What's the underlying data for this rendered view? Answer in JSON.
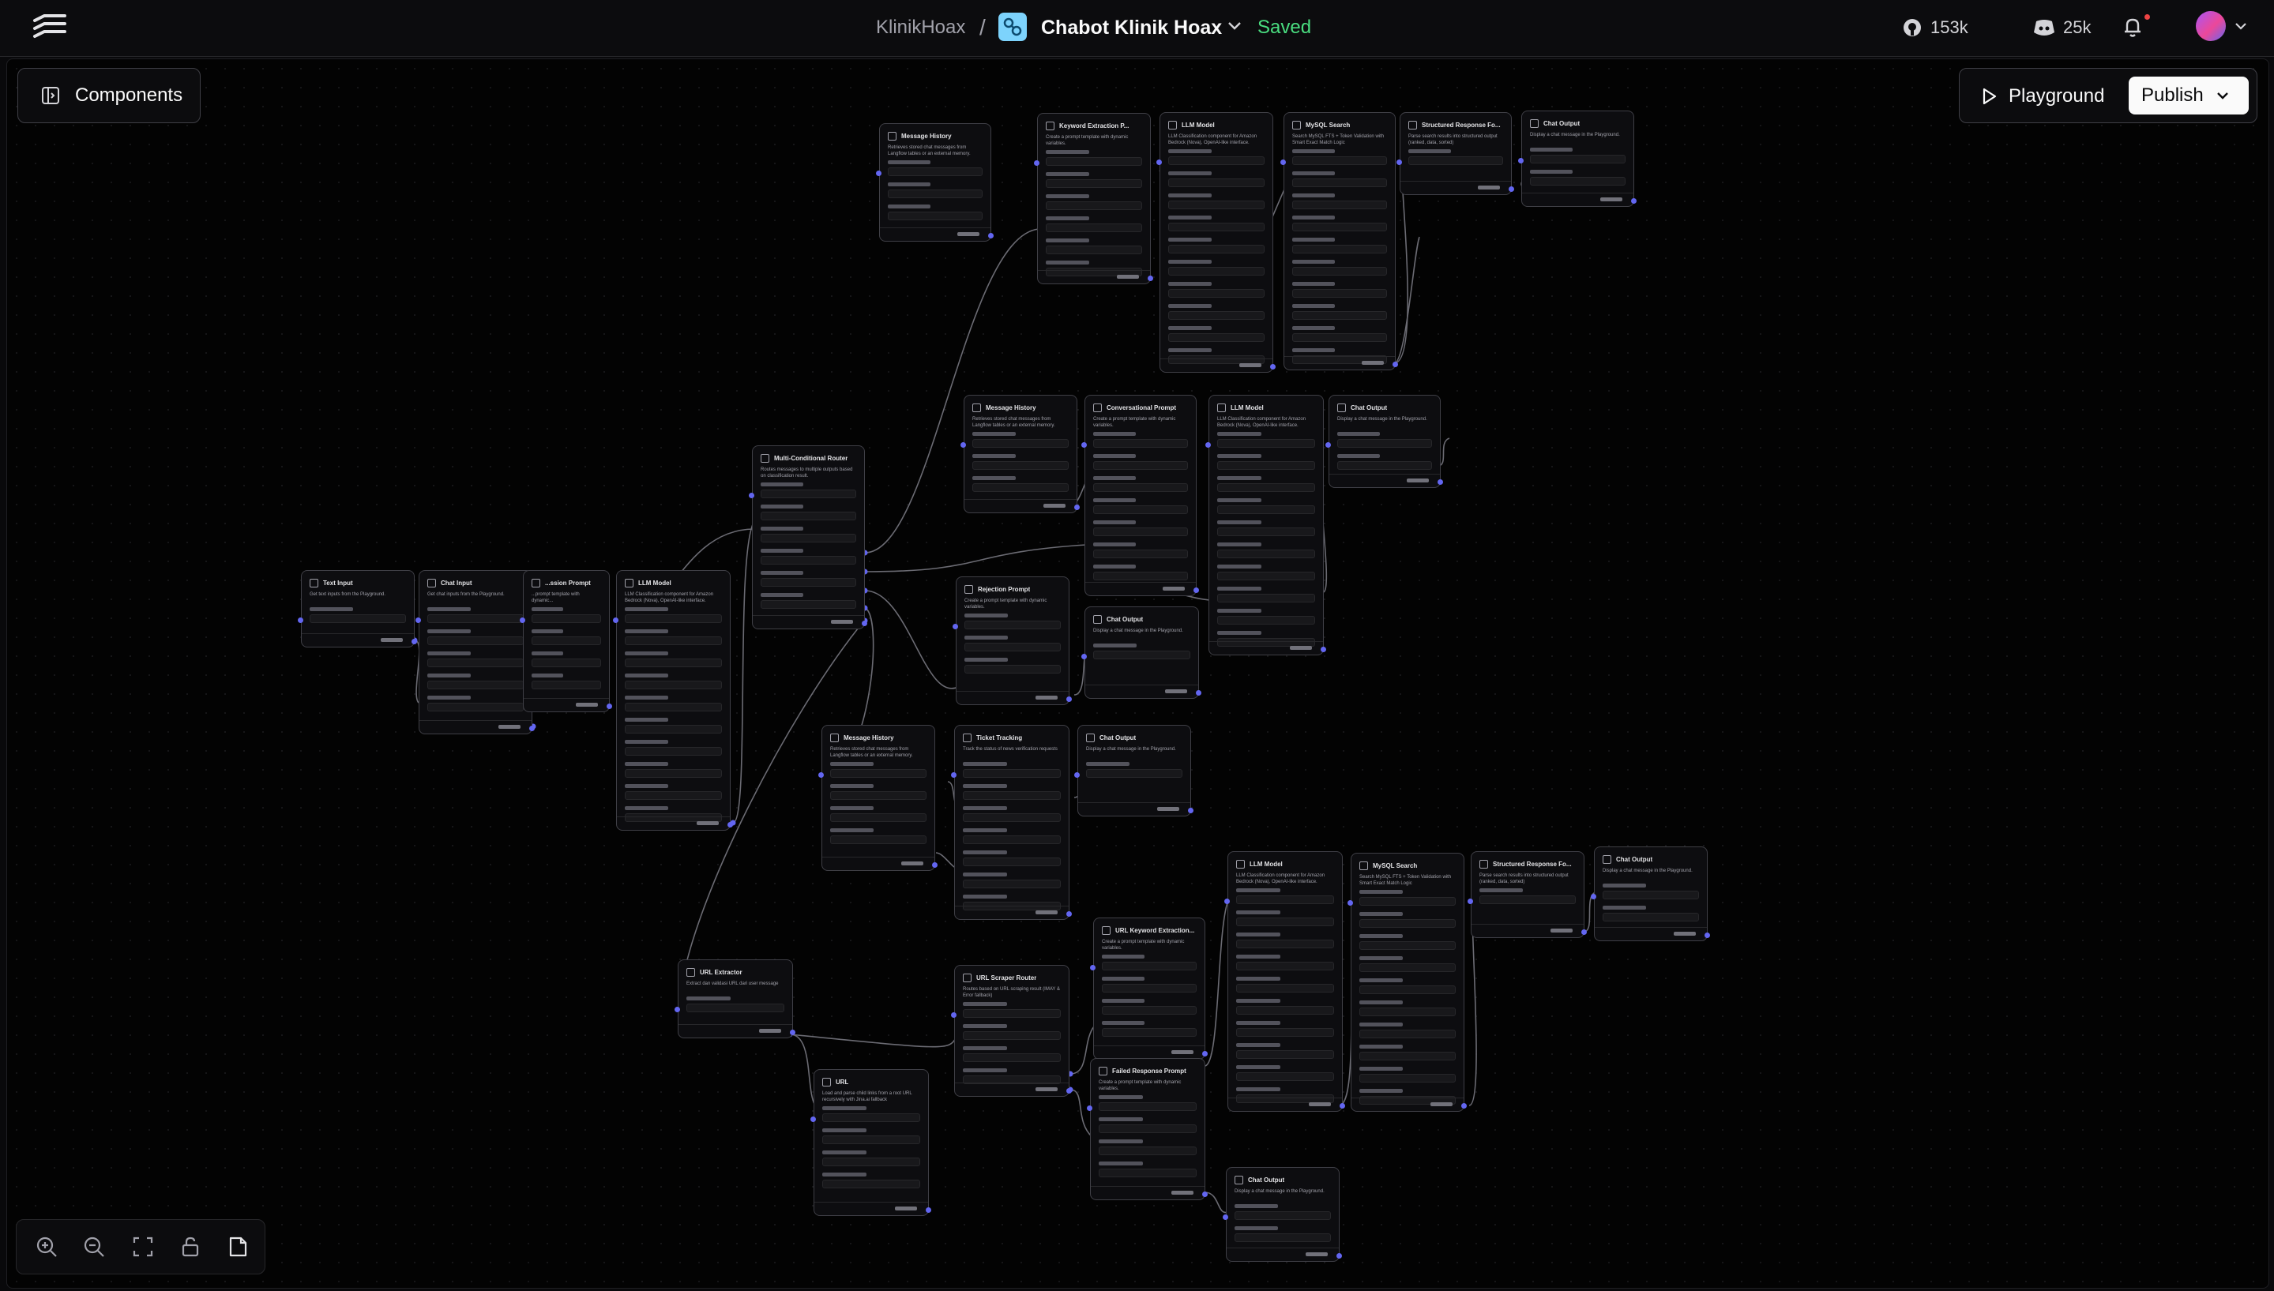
{
  "header": {
    "project": "KlinikHoax",
    "separator": "/",
    "flow_name": "Chabot Klinik Hoax",
    "status": "Saved",
    "github_count": "153k",
    "discord_count": "25k"
  },
  "toolbar": {
    "components_label": "Components",
    "playground_label": "Playground",
    "publish_label": "Publish"
  },
  "nodes": [
    {
      "title": "Message History",
      "desc": "Retrieves stored chat messages from Langflow tables or an external memory."
    },
    {
      "title": "Keyword Extraction P...",
      "desc": "Create a prompt template with dynamic variables."
    },
    {
      "title": "LLM Model",
      "desc": "LLM Classification component for Amazon Bedrock (Nova), OpenAI-like interface."
    },
    {
      "title": "MySQL Search",
      "desc": "Search MySQL FTS + Token Validation with Smart Exact Match Logic"
    },
    {
      "title": "Structured Response Fo...",
      "desc": "Parse search results into structured output (ranked, data, sorted)"
    },
    {
      "title": "Chat Output",
      "desc": "Display a chat message in the Playground."
    },
    {
      "title": "Message History",
      "desc": "Retrieves stored chat messages from Langflow tables or an external memory."
    },
    {
      "title": "Conversational Prompt",
      "desc": "Create a prompt template with dynamic variables."
    },
    {
      "title": "LLM Model",
      "desc": "LLM Classification component for Amazon Bedrock (Nova), OpenAI-like interface."
    },
    {
      "title": "Chat Output",
      "desc": "Display a chat message in the Playground."
    },
    {
      "title": "Multi-Conditional Router",
      "desc": "Routes messages to multiple outputs based on classification result."
    },
    {
      "title": "Text Input",
      "desc": "Get text inputs from the Playground."
    },
    {
      "title": "Chat Input",
      "desc": "Get chat inputs from the Playground."
    },
    {
      "title": "...ssion Prompt",
      "desc": "...prompt template with dynamic..."
    },
    {
      "title": "LLM Model",
      "desc": "LLM Classification component for Amazon Bedrock (Nova), OpenAI-like interface."
    },
    {
      "title": "Rejection Prompt",
      "desc": "Create a prompt template with dynamic variables."
    },
    {
      "title": "Chat Output",
      "desc": "Display a chat message in the Playground."
    },
    {
      "title": "Message History",
      "desc": "Retrieves stored chat messages from Langflow tables or an external memory."
    },
    {
      "title": "Ticket Tracking",
      "desc": "Track the status of news verification requests"
    },
    {
      "title": "Chat Output",
      "desc": "Display a chat message in the Playground."
    },
    {
      "title": "LLM Model",
      "desc": "LLM Classification component for Amazon Bedrock (Nova), OpenAI-like interface."
    },
    {
      "title": "MySQL Search",
      "desc": "Search MySQL FTS + Token Validation with Smart Exact Match Logic"
    },
    {
      "title": "Structured Response Fo...",
      "desc": "Parse search results into structured output (ranked, data, sorted)"
    },
    {
      "title": "Chat Output",
      "desc": "Display a chat message in the Playground."
    },
    {
      "title": "URL Keyword Extraction...",
      "desc": "Create a prompt template with dynamic variables."
    },
    {
      "title": "URL Extractor",
      "desc": "Extract dan validasi URL dari user message"
    },
    {
      "title": "URL Scraper Router",
      "desc": "Routes based on URL scraping result (IMAY & Error fallback)"
    },
    {
      "title": "URL",
      "desc": "Load and parse child links from a root URL recursively with Jina.ai fallback"
    },
    {
      "title": "Failed Response Prompt",
      "desc": "Create a prompt template with dynamic variables."
    },
    {
      "title": "Chat Output",
      "desc": "Display a chat message in the Playground."
    }
  ]
}
